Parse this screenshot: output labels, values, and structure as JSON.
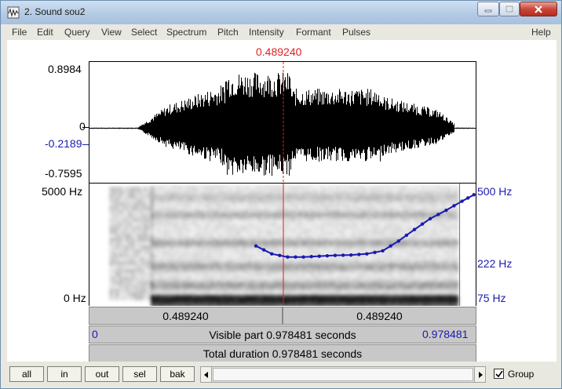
{
  "window": {
    "title": "2. Sound sou2",
    "controls": [
      "minimize",
      "maximize",
      "close"
    ]
  },
  "menu": {
    "items": [
      "File",
      "Edit",
      "Query",
      "View",
      "Select",
      "Spectrum",
      "Pitch",
      "Intensity",
      "Formant",
      "Pulses"
    ],
    "help": "Help"
  },
  "cursor": {
    "time_label": "0.489240",
    "time_seconds": 0.48924
  },
  "waveform": {
    "ymax_label": "0.8984",
    "zero_label": "0",
    "cursor_value_label": "-0.2189",
    "ymin_label": "-0.7595",
    "ymax": 0.8984,
    "ymin": -0.7595,
    "cursor_value": -0.2189
  },
  "spectrogram": {
    "freq_max_label": "5000 Hz",
    "freq_min_label": "0 Hz",
    "pitch_max_label": "500 Hz",
    "pitch_cursor_label": "222 Hz",
    "pitch_min_label": "75 Hz"
  },
  "time_bars": {
    "left_segment": "0.489240",
    "right_segment": "0.489240",
    "visible_start": "0",
    "visible_part": "Visible part 0.978481 seconds",
    "visible_end": "0.978481",
    "total_duration": "Total duration 0.978481 seconds",
    "duration_seconds": 0.978481
  },
  "pitch_track": {
    "time": [
      0.42,
      0.46,
      0.5,
      0.54,
      0.58,
      0.62,
      0.66,
      0.7,
      0.74,
      0.78,
      0.82,
      0.86,
      0.9,
      0.94,
      0.97
    ],
    "hz": [
      190,
      168,
      160,
      160,
      162,
      164,
      165,
      168,
      176,
      205,
      245,
      290,
      330,
      380,
      420
    ]
  },
  "bottom": {
    "buttons": [
      "all",
      "in",
      "out",
      "sel",
      "bak"
    ],
    "group_label": "Group",
    "group_checked": true
  },
  "colors": {
    "cursor": "#dd2222",
    "pitch": "#1a1aaf",
    "bar_bg": "#c8c8c8"
  }
}
